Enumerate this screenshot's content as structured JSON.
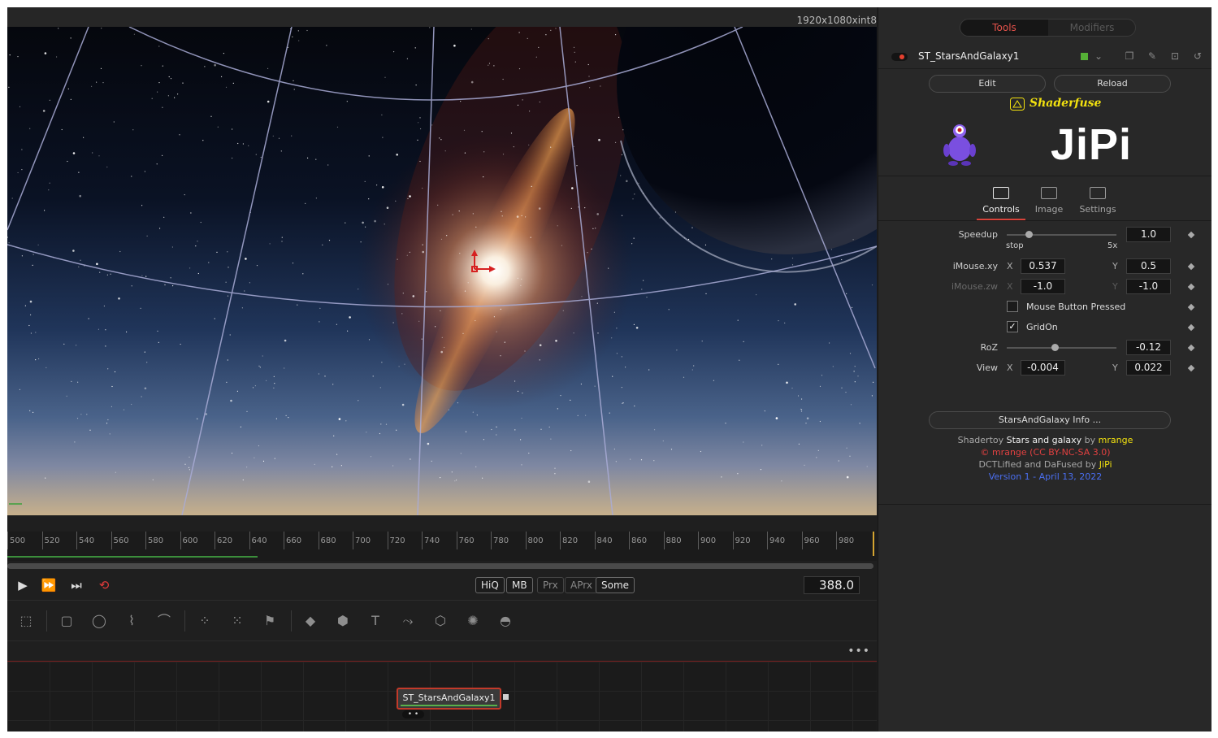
{
  "viewer": {
    "resolution": "1920x1080xint8"
  },
  "timeline": {
    "ticks": [
      "500",
      "520",
      "540",
      "560",
      "580",
      "600",
      "620",
      "640",
      "660",
      "680",
      "700",
      "720",
      "740",
      "760",
      "780",
      "800",
      "820",
      "840",
      "860",
      "880",
      "900",
      "920",
      "940",
      "960",
      "980"
    ]
  },
  "transport": {
    "play_icon": "play-icon",
    "step_forward_icon": "fast-forward-icon",
    "skip_end_icon": "skip-to-end-icon",
    "loop_icon": "loop-icon",
    "quality_buttons": [
      "HiQ",
      "MB",
      "Prx",
      "APrx",
      "Some"
    ],
    "current_frame": "388.0"
  },
  "toolbar": {
    "tools": [
      "background-icon",
      "rectangle-mask-icon",
      "ellipse-mask-icon",
      "polygon-mask-icon",
      "bspline-mask-icon",
      "particle-emitter-icon",
      "particle-render-icon",
      "particle-bitmap-icon",
      "shape-3d-icon",
      "merge-3d-icon",
      "text-3d-icon",
      "transform-3d-icon",
      "renderer-3d-icon",
      "camera-3d-icon",
      "light-3d-icon"
    ]
  },
  "nodes": {
    "more_label": "•••",
    "node_label": "ST_StarsAndGalaxy1",
    "node_dots": "• •"
  },
  "inspector": {
    "tabs_top": {
      "tools": "Tools",
      "modifiers": "Modifiers"
    },
    "tool_name": "ST_StarsAndGalaxy1",
    "edit_label": "Edit",
    "reload_label": "Reload",
    "shaderfuse_label": "Shaderfuse",
    "logo_text": "JiPi",
    "tabs": [
      {
        "label": "Controls",
        "icon": "controls-icon"
      },
      {
        "label": "Image",
        "icon": "image-icon"
      },
      {
        "label": "Settings",
        "icon": "settings-icon"
      }
    ],
    "controls": {
      "speedup": {
        "label": "Speedup",
        "value": "1.0",
        "min_label": "stop",
        "max_label": "5x",
        "level": 0.2
      },
      "imouse_xy": {
        "label": "iMouse.xy",
        "x_axis": "X",
        "x": "0.537",
        "y_axis": "Y",
        "y": "0.5"
      },
      "imouse_zw": {
        "label": "iMouse.zw",
        "x_axis": "X",
        "x": "-1.0",
        "y_axis": "Y",
        "y": "-1.0"
      },
      "mouse_button": {
        "label": "Mouse Button Pressed",
        "checked": false
      },
      "gridon": {
        "label": "GridOn",
        "checked": true,
        "mark": "✓"
      },
      "roz": {
        "label": "RoZ",
        "value": "-0.12",
        "level": 0.44
      },
      "view": {
        "label": "View",
        "x_axis": "X",
        "x": "-0.004",
        "y_axis": "Y",
        "y": "0.022"
      }
    },
    "info_button": "StarsAndGalaxy Info ...",
    "credits": {
      "line1_prefix": "Shadertoy ",
      "line1_title": "Stars and galaxy",
      "line1_by": " by ",
      "line1_author": "mrange",
      "line2": "© mrange (CC BY-NC-SA 3.0)",
      "line3_prefix": "DCTLified and DaFused by ",
      "line3_author": "JiPi",
      "line4": "Version 1 - April 13, 2022"
    },
    "colors": {
      "accent_red": "#e5524b",
      "yellow": "#f2e10f",
      "credit_red": "#e04040",
      "credit_blue": "#4a6ef0",
      "credit_white": "#f0f0f0"
    }
  }
}
